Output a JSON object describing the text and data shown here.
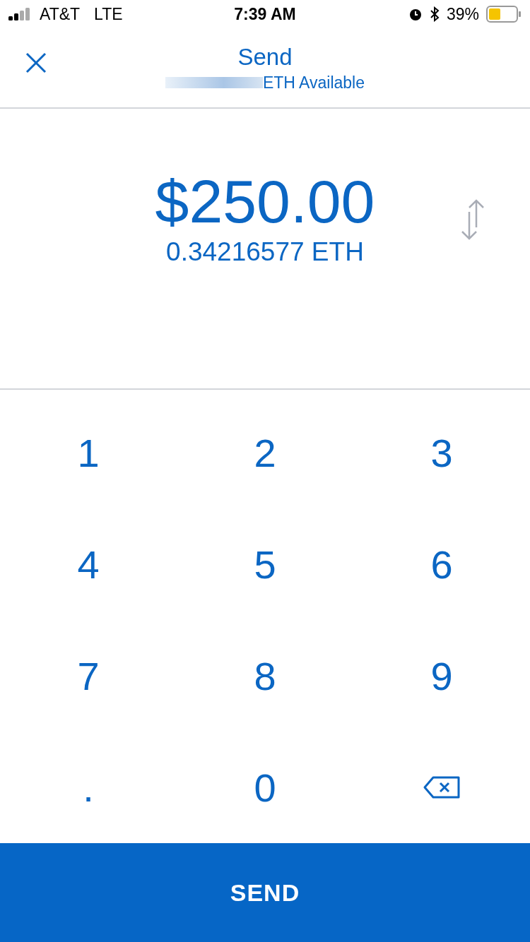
{
  "status_bar": {
    "carrier": "AT&T",
    "network": "LTE",
    "time": "7:39 AM",
    "battery": "39%"
  },
  "header": {
    "title": "Send",
    "subtitle": "ETH Available"
  },
  "amount": {
    "fiat": "$250.00",
    "crypto": "0.34216577 ETH"
  },
  "keypad": [
    {
      "kind": "key",
      "label": "1"
    },
    {
      "kind": "key",
      "label": "2"
    },
    {
      "kind": "key",
      "label": "3"
    },
    {
      "kind": "key",
      "label": "4"
    },
    {
      "kind": "key",
      "label": "5"
    },
    {
      "kind": "key",
      "label": "6"
    },
    {
      "kind": "key",
      "label": "7"
    },
    {
      "kind": "key",
      "label": "8"
    },
    {
      "kind": "key",
      "label": "9"
    },
    {
      "kind": "key",
      "label": "."
    },
    {
      "kind": "key",
      "label": "0"
    },
    {
      "kind": "backspace"
    }
  ],
  "send_button": {
    "label": "SEND"
  }
}
